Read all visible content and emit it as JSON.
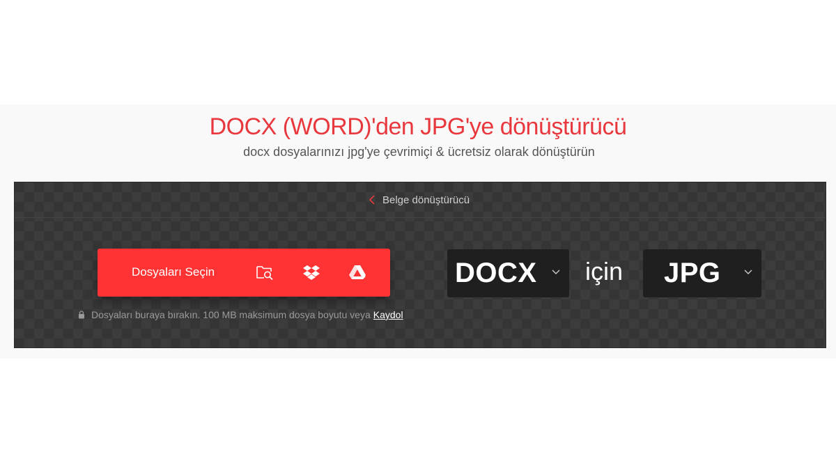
{
  "header": {
    "title": "DOCX (WORD)'den JPG'ye dönüştürücü",
    "subtitle": "docx dosyalarınızı jpg'ye çevrimiçi & ücretsiz olarak dönüştürün"
  },
  "nav": {
    "back_label": "Belge dönüştürücü"
  },
  "upload": {
    "button_label": "Dosyaları Seçin",
    "sources": [
      "folder-search-icon",
      "dropbox-icon",
      "google-drive-icon"
    ],
    "drop_hint": "Dosyaları buraya bırakın. 100 MB maksimum dosya boyutu veya",
    "signup_link": "Kaydol"
  },
  "conversion": {
    "from_format": "DOCX",
    "connector": "için",
    "to_format": "JPG"
  },
  "colors": {
    "accent": "#e8383d",
    "button": "#ff3334",
    "panel": "#353535",
    "select_bg": "#1f1f1f"
  }
}
